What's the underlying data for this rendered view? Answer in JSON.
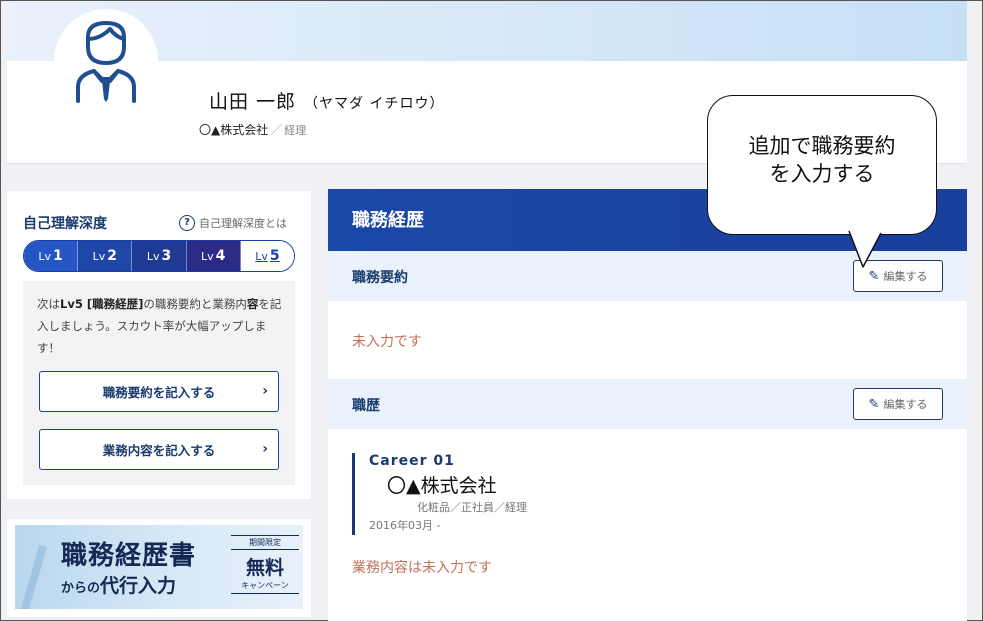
{
  "profile": {
    "name": "山田 一郎",
    "kana": "（ヤマダ イチロウ）",
    "company": "〇▲株式会社",
    "separator": "／",
    "role": "経理"
  },
  "level": {
    "title": "自己理解深度",
    "help_label": "自己理解深度とは",
    "levels": [
      {
        "prefix": "Lv",
        "num": "1"
      },
      {
        "prefix": "Lv",
        "num": "2"
      },
      {
        "prefix": "Lv",
        "num": "3"
      },
      {
        "prefix": "Lv",
        "num": "4"
      },
      {
        "prefix": "Lv",
        "num": "5"
      }
    ],
    "next_text_1": "次は",
    "next_text_bold": "Lv5 [職務経歴]",
    "next_text_2": "の職務要約と業務内",
    "next_text_bold2": "容",
    "next_text_3": "を記入しましょう。スカウト率が大幅アップします！",
    "cta1": "職務要約を記入する",
    "cta2": "業務内容を記入する",
    "chevron": "›"
  },
  "promo": {
    "title": "職務経歴書",
    "sub_small": "からの",
    "sub": "代行入力",
    "limited": "期間限定",
    "free": "無料",
    "campaign": "キャンペーン"
  },
  "main": {
    "header": "職務経歴",
    "summary_label": "職務要約",
    "edit_label": "編集する",
    "summary_empty": "未入力です",
    "history_label": "職歴",
    "career": {
      "no": "Career 01",
      "company": "〇▲株式会社",
      "meta": "化粧品／正社員／経理",
      "date": "2016年03月 -",
      "empty": "業務内容は未入力です"
    }
  },
  "callout": {
    "line1": "追加で職務要約",
    "line2": "を入力する"
  }
}
